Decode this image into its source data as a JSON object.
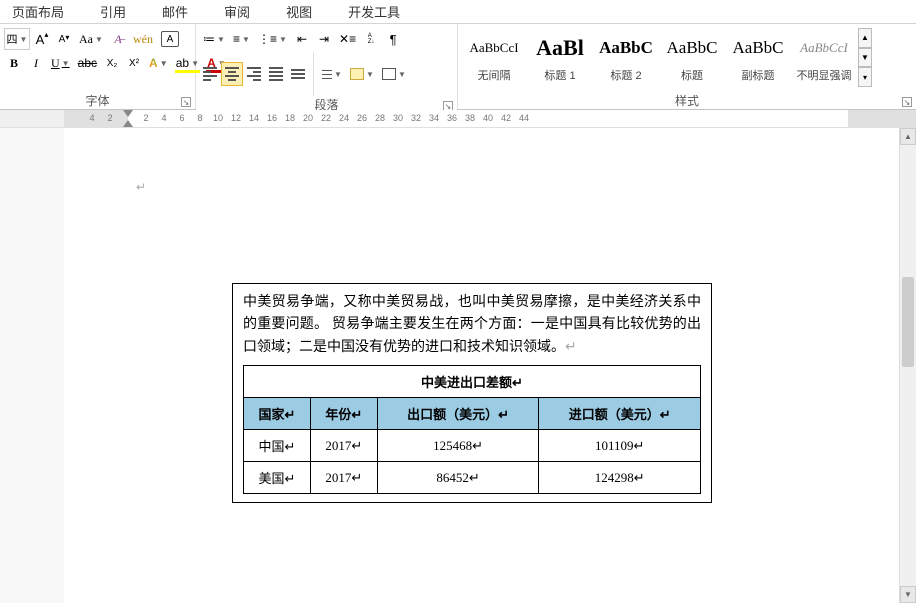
{
  "menu": {
    "layout": "页面布局",
    "ref": "引用",
    "mail": "邮件",
    "review": "审阅",
    "view": "视图",
    "dev": "开发工具"
  },
  "font": {
    "size": "四",
    "grow": "A",
    "shrink": "A",
    "case": "Aa",
    "pinyin": "wén",
    "circled": "A",
    "bold": "B",
    "italic": "I",
    "underline": "U",
    "strike": "abc",
    "sub": "X₂",
    "sup": "X²",
    "effect": "A",
    "highlight": "ab",
    "color": "A",
    "label": "字体"
  },
  "para": {
    "sortAZ": "A",
    "sortArrow": "Z↓",
    "marks": "¶",
    "indentArrow": "⇥",
    "outdentArrow": "⇤",
    "label": "段落"
  },
  "styles": {
    "label": "样式",
    "items": [
      {
        "preview": "AaBbCcI",
        "name": "无间隔",
        "css": "font-size:13px;"
      },
      {
        "preview": "AaBl",
        "name": "标题 1",
        "css": "font-size:22px;font-weight:bold;"
      },
      {
        "preview": "AaBbC",
        "name": "标题 2",
        "css": "font-size:17px;font-weight:bold;"
      },
      {
        "preview": "AaBbC",
        "name": "标题",
        "css": "font-size:17px;"
      },
      {
        "preview": "AaBbC",
        "name": "副标题",
        "css": "font-size:17px;"
      },
      {
        "preview": "AaBbCcI",
        "name": "不明显强调",
        "css": "font-size:13px;font-style:italic;color:#888;"
      }
    ]
  },
  "doc": {
    "intro": "中美贸易争端，又称中美贸易战，也叫中美贸易摩擦，是中美经济关系中的重要问题。 贸易争端主要发生在两个方面：一是中国具有比较优势的出口领域；二是中国没有优势的进口和技术知识领域。",
    "table": {
      "title": "中美进出口差额",
      "headers": [
        "国家",
        "年份",
        "出口额（美元）",
        "进口额（美元）"
      ],
      "rows": [
        [
          "中国",
          "2017",
          "125468",
          "101109"
        ],
        [
          "美国",
          "2017",
          "86452",
          "124298"
        ]
      ]
    }
  },
  "ruler": {
    "ticks": [
      "4",
      "2",
      "",
      "2",
      "4",
      "6",
      "8",
      "10",
      "12",
      "14",
      "16",
      "18",
      "20",
      "22",
      "24",
      "26",
      "28",
      "30",
      "32",
      "34",
      "36",
      "38",
      "40",
      "42",
      "44"
    ]
  }
}
